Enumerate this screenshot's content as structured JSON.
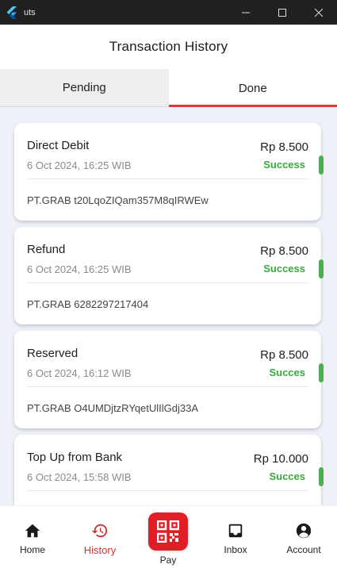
{
  "window": {
    "title": "uts",
    "controls": [
      "minimize-icon",
      "maximize-icon",
      "close-icon"
    ]
  },
  "header": {
    "title": "Transaction History"
  },
  "tabs": [
    {
      "label": "Pending",
      "selected": false
    },
    {
      "label": "Done",
      "selected": true
    }
  ],
  "transactions": [
    {
      "type": "Direct Debit",
      "date": "6 Oct 2024, 16:25 WIB",
      "amount": "Rp 8.500",
      "status": "Success",
      "reference": "PT.GRAB t20LqoZIQam357M8qIRWEw"
    },
    {
      "type": "Refund",
      "date": "6 Oct 2024, 16:25 WIB",
      "amount": "Rp 8.500",
      "status": "Success",
      "reference": "PT.GRAB 6282297217404"
    },
    {
      "type": "Reserved",
      "date": "6 Oct 2024, 16:12 WIB",
      "amount": "Rp 8.500",
      "status": "Succes",
      "reference": "PT.GRAB O4UMDjtzRYqetUlIlGdj33A"
    },
    {
      "type": "Top Up from Bank",
      "date": "6 Oct 2024, 15:58 WIB",
      "amount": "Rp 10.000",
      "status": "Succes",
      "reference": ""
    }
  ],
  "bottom_nav": {
    "home": "Home",
    "history": "History",
    "pay": "Pay",
    "inbox": "Inbox",
    "account": "Account"
  },
  "colors": {
    "accent": "#e53935",
    "pay_button": "#e01e26",
    "success": "#3ba83f",
    "list_background": "#eef1f8"
  }
}
